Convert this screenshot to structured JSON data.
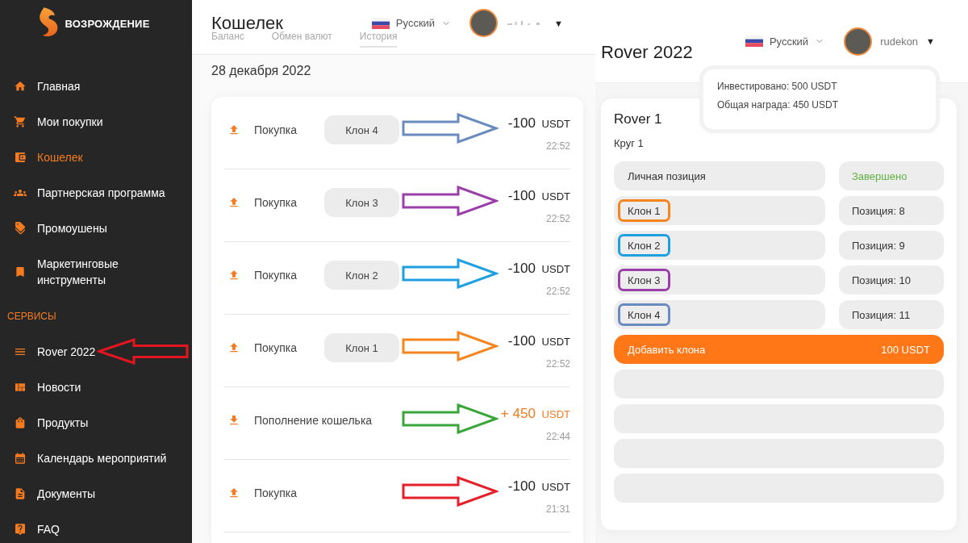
{
  "sidebar": {
    "logo_text": "ВОЗРОЖДЕНИЕ",
    "items": [
      {
        "label": "Главная",
        "selected": false,
        "annotated": false
      },
      {
        "label": "Мои покупки",
        "selected": false,
        "annotated": false
      },
      {
        "label": "Кошелек",
        "selected": true,
        "annotated": false
      },
      {
        "label": "Партнерская программа",
        "selected": false,
        "annotated": false
      },
      {
        "label": "Промоушены",
        "selected": false,
        "annotated": false
      },
      {
        "label": "Маркетинговые инструменты",
        "selected": false,
        "annotated": false
      }
    ],
    "section_title": "СЕРВИСЫ",
    "section_items": [
      {
        "label": "Rover 2022",
        "selected": false,
        "annotated": true
      },
      {
        "label": "Новости",
        "selected": false,
        "annotated": false
      },
      {
        "label": "Продукты",
        "selected": false,
        "annotated": false
      },
      {
        "label": "Календарь мероприятий",
        "selected": false,
        "annotated": false
      },
      {
        "label": "Документы",
        "selected": false,
        "annotated": false
      },
      {
        "label": "FAQ",
        "selected": false,
        "annotated": false
      }
    ]
  },
  "wallet": {
    "title": "Кошелек",
    "tabs": [
      {
        "label": "Баланс",
        "selected": false
      },
      {
        "label": "Обмен валют",
        "selected": false
      },
      {
        "label": "История",
        "selected": true
      }
    ],
    "header": {
      "language": "Русский",
      "caret": "▼"
    },
    "date": "28 декабря 2022",
    "transactions": [
      {
        "kind": "purchase",
        "label": "Покупка",
        "clone": "Клон 4",
        "amount": "-100",
        "currency": "USDT",
        "time": "22:52",
        "color": "#6a8bbf"
      },
      {
        "kind": "purchase",
        "label": "Покупка",
        "clone": "Клон 3",
        "amount": "-100",
        "currency": "USDT",
        "time": "22:52",
        "color": "#9a3fa8"
      },
      {
        "kind": "purchase",
        "label": "Покупка",
        "clone": "Клон 2",
        "amount": "-100",
        "currency": "USDT",
        "time": "22:52",
        "color": "#1ea0e0"
      },
      {
        "kind": "purchase",
        "label": "Покупка",
        "clone": "Клон 1",
        "amount": "-100",
        "currency": "USDT",
        "time": "22:52",
        "color": "#f5851f"
      },
      {
        "kind": "deposit",
        "label": "Пополнение кошелька",
        "amount": "+ 450",
        "currency": "USDT",
        "time": "22:44",
        "color": "#3aa63a"
      },
      {
        "kind": "purchase",
        "label": "Покупка",
        "amount": "-100",
        "currency": "USDT",
        "time": "21:31",
        "color": "#e5202a"
      }
    ]
  },
  "rover": {
    "title": "Rover 2022",
    "header": {
      "language": "Русский",
      "username": "rudekon",
      "caret": "▼"
    },
    "popup": {
      "lines": [
        "Инвестировано: 500 USDT",
        "Общая награда: 450 USDT"
      ]
    },
    "card": {
      "title": "Rover 1",
      "round": "Круг 1",
      "rows": [
        {
          "kind": "personal",
          "label": "Личная позиция",
          "status": "Завершено",
          "completed": true
        },
        {
          "kind": "clone",
          "label": "Клон 1",
          "status": "Позиция: 8",
          "completed": false,
          "color": "#f5851f"
        },
        {
          "kind": "clone",
          "label": "Клон 2",
          "status": "Позиция: 9",
          "completed": false,
          "color": "#1ea0e0"
        },
        {
          "kind": "clone",
          "label": "Клон 3",
          "status": "Позиция: 10",
          "completed": false,
          "color": "#9a3fa8"
        },
        {
          "kind": "clone",
          "label": "Клон 4",
          "status": "Позиция: 11",
          "completed": false,
          "color": "#6a8bbf"
        },
        {
          "kind": "action",
          "label": "Добавить клона",
          "price": "100 USDT"
        },
        {
          "kind": "empty"
        },
        {
          "kind": "empty"
        },
        {
          "kind": "empty"
        },
        {
          "kind": "empty"
        }
      ]
    }
  }
}
